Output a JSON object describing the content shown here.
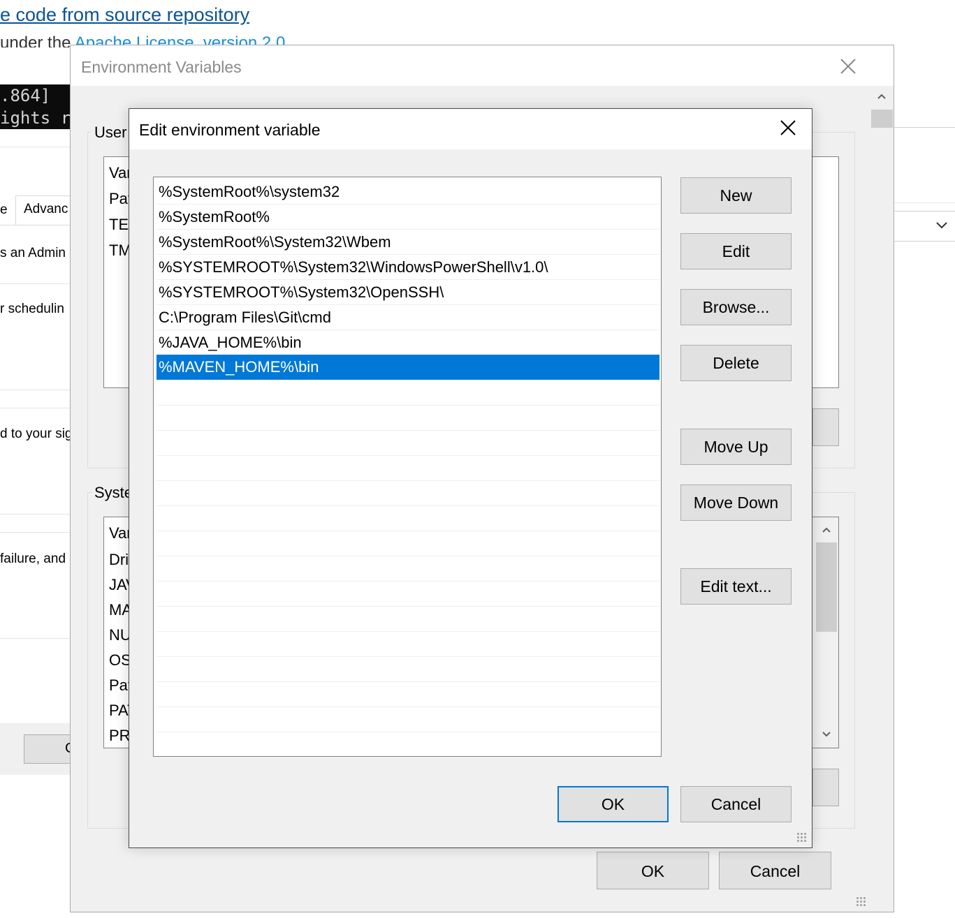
{
  "background_page": {
    "link_text": "e code from source repository",
    "license_prefix": "under the ",
    "license_link": "Apache License, version 2.0",
    "terminal_lines": [
      ".864]",
      "ights r"
    ],
    "tab_prev": "e",
    "tab_advanced": "Advanc",
    "lines": [
      "s an Admin",
      "r schedulin",
      "d to your sig",
      "failure, and"
    ],
    "bottom_button": "C"
  },
  "env_vars_dialog": {
    "title": "Environment Variables",
    "user_group_label": "User",
    "user_list": [
      "Var",
      "Pat",
      "TEI",
      "TM"
    ],
    "system_group_label": "Syste",
    "system_list": [
      "Var",
      "Dri",
      "JAV",
      "MA",
      "NU",
      "OS",
      "Pat",
      "PAT",
      "PR"
    ],
    "ok_label": "OK",
    "cancel_label": "Cancel"
  },
  "edit_dialog": {
    "title": "Edit environment variable",
    "entries": [
      "%SystemRoot%\\system32",
      "%SystemRoot%",
      "%SystemRoot%\\System32\\Wbem",
      "%SYSTEMROOT%\\System32\\WindowsPowerShell\\v1.0\\",
      "%SYSTEMROOT%\\System32\\OpenSSH\\",
      "C:\\Program Files\\Git\\cmd",
      "%JAVA_HOME%\\bin",
      "%MAVEN_HOME%\\bin"
    ],
    "selected_index": 7,
    "buttons": {
      "new": "New",
      "edit": "Edit",
      "browse": "Browse...",
      "delete": "Delete",
      "move_up": "Move Up",
      "move_down": "Move Down",
      "edit_text": "Edit text..."
    },
    "ok_label": "OK",
    "cancel_label": "Cancel"
  },
  "colors": {
    "selection": "#0078d7",
    "dialog_bg": "#f0f0f0",
    "button_bg": "#e1e1e1"
  }
}
